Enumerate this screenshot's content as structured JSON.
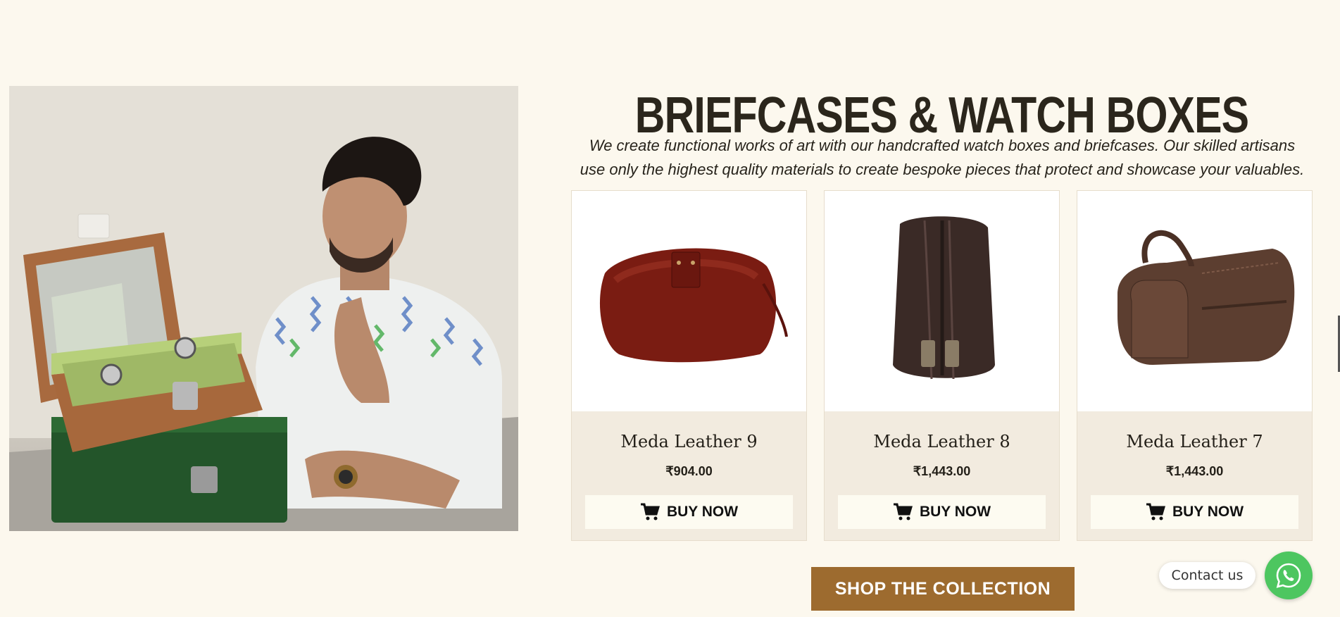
{
  "section": {
    "title": "BRIEFCASES & WATCH BOXES",
    "description": "We create functional works of art with our handcrafted watch boxes and briefcases. Our skilled artisans use only the highest quality materials to create bespoke pieces that protect and showcase your valuables."
  },
  "products": [
    {
      "name": "Meda Leather 9",
      "price": "₹904.00",
      "button_label": "BUY NOW",
      "icon": "cart-icon"
    },
    {
      "name": "Meda Leather 8",
      "price": "₹1,443.00",
      "button_label": "BUY NOW",
      "icon": "cart-icon"
    },
    {
      "name": "Meda Leather 7",
      "price": "₹1,443.00",
      "button_label": "BUY NOW",
      "icon": "cart-icon"
    }
  ],
  "cta": {
    "label": "SHOP THE COLLECTION"
  },
  "contact": {
    "label": "Contact us",
    "icon": "whatsapp-icon"
  },
  "colors": {
    "background": "#fcf8ee",
    "card_bg": "#f2ebdf",
    "cta_bg": "#9d6b2f",
    "whatsapp": "#4dc660"
  }
}
